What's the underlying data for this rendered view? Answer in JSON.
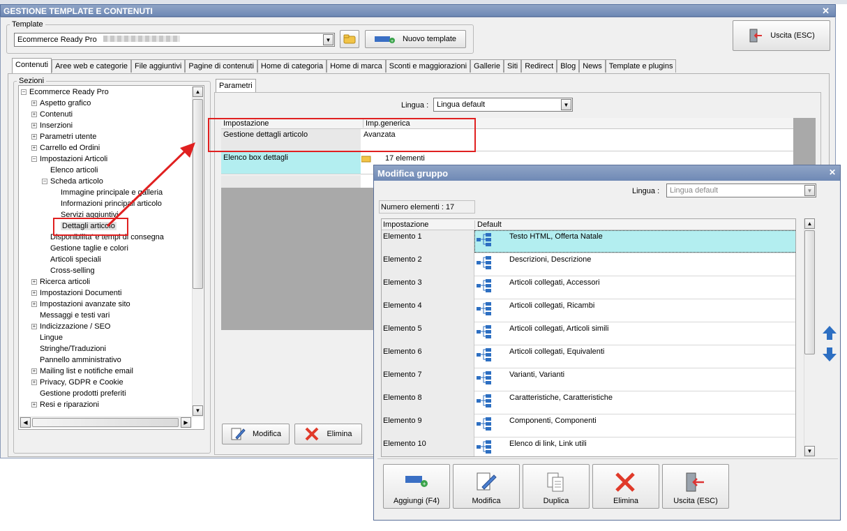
{
  "window": {
    "title": "GESTIONE TEMPLATE E CONTENUTI",
    "close": "✕"
  },
  "template": {
    "legend": "Template",
    "selected": "Ecommerce Ready Pro",
    "new_button": "Nuovo template",
    "exit_button": "Uscita (ESC)"
  },
  "tabs": [
    "Contenuti",
    "Aree web e categorie",
    "File aggiuntivi",
    "Pagine di contenuti",
    "Home di categoria",
    "Home di marca",
    "Sconti e maggiorazioni",
    "Gallerie",
    "Siti",
    "Redirect",
    "Blog",
    "News",
    "Template e plugins"
  ],
  "sections": {
    "legend": "Sezioni",
    "tree": [
      {
        "label": "Ecommerce Ready Pro",
        "level": 0,
        "toggle": "−"
      },
      {
        "label": "Aspetto grafico",
        "level": 1,
        "toggle": "+"
      },
      {
        "label": "Contenuti",
        "level": 1,
        "toggle": "+"
      },
      {
        "label": "Inserzioni",
        "level": 1,
        "toggle": "+"
      },
      {
        "label": "Parametri utente",
        "level": 1,
        "toggle": "+"
      },
      {
        "label": "Carrello ed Ordini",
        "level": 1,
        "toggle": "+"
      },
      {
        "label": "Impostazioni Articoli",
        "level": 1,
        "toggle": "−"
      },
      {
        "label": "Elenco articoli",
        "level": 2,
        "toggle": ""
      },
      {
        "label": "Scheda articolo",
        "level": 2,
        "toggle": "−"
      },
      {
        "label": "Immagine principale e galleria",
        "level": 3,
        "toggle": ""
      },
      {
        "label": "Informazioni principali articolo",
        "level": 3,
        "toggle": ""
      },
      {
        "label": "Servizi aggiuntivi",
        "level": 3,
        "toggle": ""
      },
      {
        "label": "Dettagli articolo",
        "level": 3,
        "toggle": "",
        "selected": true
      },
      {
        "label": "Disponibilita' e tempi di consegna",
        "level": 2,
        "toggle": ""
      },
      {
        "label": "Gestione taglie e colori",
        "level": 2,
        "toggle": ""
      },
      {
        "label": "Articoli speciali",
        "level": 2,
        "toggle": ""
      },
      {
        "label": "Cross-selling",
        "level": 2,
        "toggle": ""
      },
      {
        "label": "Ricerca articoli",
        "level": 1,
        "toggle": "+"
      },
      {
        "label": "Impostazioni Documenti",
        "level": 1,
        "toggle": "+"
      },
      {
        "label": "Impostazioni avanzate sito",
        "level": 1,
        "toggle": "+"
      },
      {
        "label": "Messaggi e testi vari",
        "level": 1,
        "toggle": ""
      },
      {
        "label": "Indicizzazione / SEO",
        "level": 1,
        "toggle": "+"
      },
      {
        "label": "Lingue",
        "level": 1,
        "toggle": ""
      },
      {
        "label": "Stringhe/Traduzioni",
        "level": 1,
        "toggle": ""
      },
      {
        "label": "Pannello amministrativo",
        "level": 1,
        "toggle": ""
      },
      {
        "label": "Mailing list e notifiche email",
        "level": 1,
        "toggle": "+"
      },
      {
        "label": "Privacy, GDPR e Cookie",
        "level": 1,
        "toggle": "+"
      },
      {
        "label": "Gestione prodotti preferiti",
        "level": 1,
        "toggle": ""
      },
      {
        "label": "Resi e riparazioni",
        "level": 1,
        "toggle": "+"
      }
    ]
  },
  "params": {
    "tab": "Parametri",
    "lingua_label": "Lingua :",
    "lingua_value": "Lingua default",
    "col_setting": "Impostazione",
    "col_value": "Imp.generica",
    "rows": [
      {
        "setting": "Gestione dettagli articolo",
        "value": "Avanzata"
      },
      {
        "setting": "Elenco box dettagli",
        "value": "17 elementi"
      }
    ],
    "edit_button": "Modifica",
    "delete_button": "Elimina"
  },
  "dialog": {
    "title": "Modifica gruppo",
    "close": "✕",
    "lingua_label": "Lingua :",
    "lingua_value": "Lingua default",
    "count": "Numero elementi : 17",
    "col_setting": "Impostazione",
    "col_default": "Default",
    "rows": [
      {
        "key": "Elemento 1",
        "value": "Testo HTML, Offerta Natale",
        "selected": true
      },
      {
        "key": "Elemento 2",
        "value": "Descrizioni, Descrizione"
      },
      {
        "key": "Elemento 3",
        "value": "Articoli collegati, Accessori"
      },
      {
        "key": "Elemento 4",
        "value": "Articoli collegati, Ricambi"
      },
      {
        "key": "Elemento 5",
        "value": "Articoli collegati, Articoli simili"
      },
      {
        "key": "Elemento 6",
        "value": "Articoli collegati, Equivalenti"
      },
      {
        "key": "Elemento 7",
        "value": "Varianti, Varianti"
      },
      {
        "key": "Elemento 8",
        "value": "Caratteristiche, Caratteristiche"
      },
      {
        "key": "Elemento 9",
        "value": "Componenti, Componenti"
      },
      {
        "key": "Elemento 10",
        "value": "Elenco di link, Link utili"
      }
    ],
    "buttons": {
      "add": "Aggiungi (F4)",
      "edit": "Modifica",
      "duplicate": "Duplica",
      "delete": "Elimina",
      "exit": "Uscita (ESC)"
    }
  },
  "colors": {
    "accent_row": "#b3eef0",
    "highlight_red": "#e02020",
    "titlebar": "#7a92bd"
  }
}
